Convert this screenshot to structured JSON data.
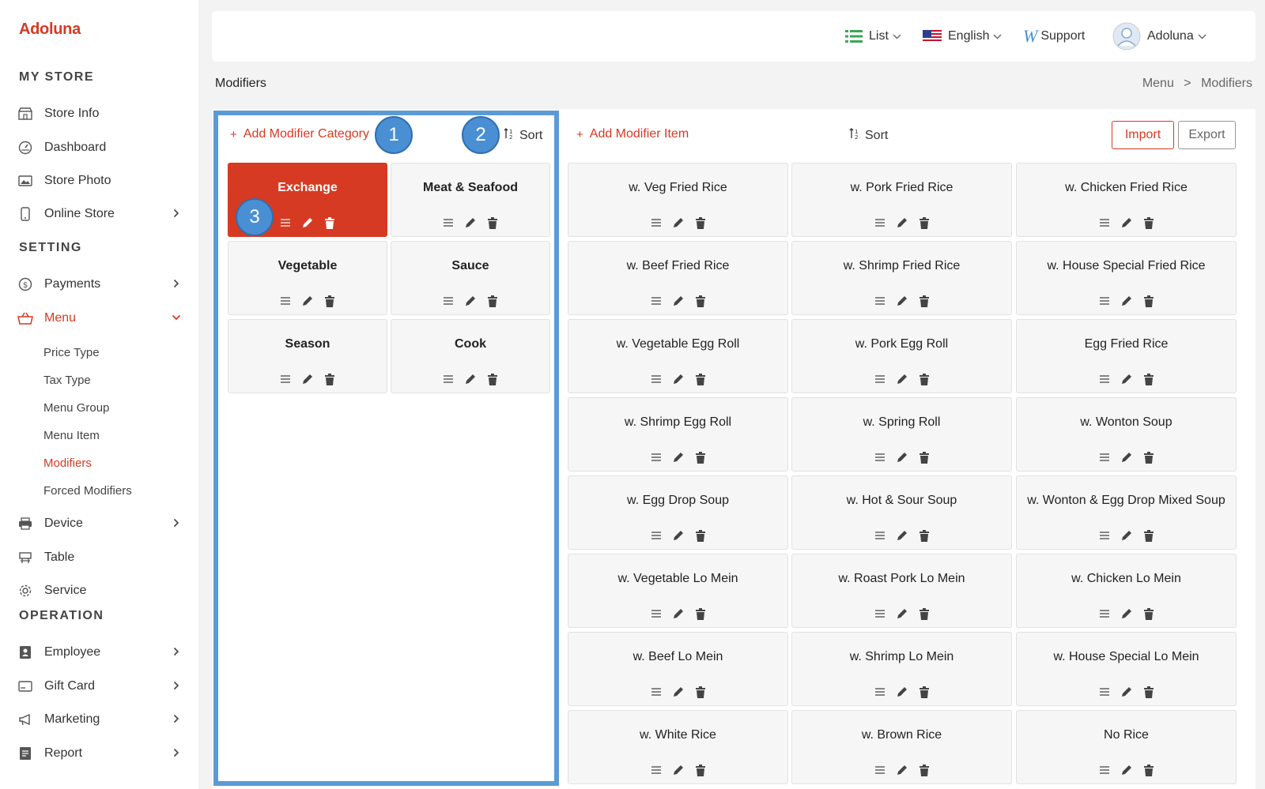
{
  "brand": "Adoluna",
  "sidebar": {
    "sections": {
      "my_store": "MY STORE",
      "setting": "SETTING",
      "operation": "OPERATION"
    },
    "items": {
      "store_info": "Store Info",
      "dashboard": "Dashboard",
      "store_photo": "Store Photo",
      "online_store": "Online Store",
      "payments": "Payments",
      "menu": "Menu",
      "device": "Device",
      "table": "Table",
      "service": "Service",
      "employee": "Employee",
      "gift_card": "Gift Card",
      "marketing": "Marketing",
      "report": "Report"
    },
    "menu_sub": {
      "price_type": "Price Type",
      "tax_type": "Tax Type",
      "menu_group": "Menu Group",
      "menu_item": "Menu Item",
      "modifiers": "Modifiers",
      "forced_modifiers": "Forced Modifiers"
    }
  },
  "topbar": {
    "view": "List",
    "language": "English",
    "support": "Support",
    "user": "Adoluna"
  },
  "page": {
    "title": "Modifiers",
    "crumb_parent": "Menu",
    "crumb_sep": ">",
    "crumb_current": "Modifiers"
  },
  "categories_panel": {
    "add_label": "Add Modifier Category",
    "sort_label": "Sort",
    "categories": [
      "Exchange",
      "Meat & Seafood",
      "Vegetable",
      "Sauce",
      "Season",
      "Cook"
    ],
    "selected_index": 0
  },
  "items_panel": {
    "add_label": "Add Modifier Item",
    "sort_label": "Sort",
    "import_label": "Import",
    "export_label": "Export",
    "items": [
      "w. Veg Fried Rice",
      "w. Pork Fried Rice",
      "w. Chicken Fried Rice",
      "w. Beef Fried Rice",
      "w. Shrimp Fried Rice",
      "w. House Special Fried Rice",
      "w. Vegetable Egg Roll",
      "w. Pork Egg Roll",
      "Egg Fried Rice",
      "w. Shrimp Egg Roll",
      "w. Spring Roll",
      "w. Wonton Soup",
      "w. Egg Drop Soup",
      "w. Hot & Sour Soup",
      "w. Wonton & Egg Drop Mixed Soup",
      "w. Vegetable Lo Mein",
      "w. Roast Pork Lo Mein",
      "w. Chicken Lo Mein",
      "w. Beef Lo Mein",
      "w. Shrimp Lo Mein",
      "w. House Special Lo Mein",
      "w. White Rice",
      "w. Brown Rice",
      "No Rice"
    ]
  },
  "annotations": [
    "1",
    "2",
    "3"
  ],
  "colors": {
    "accent": "#d63a22",
    "highlight": "#5b9bd5",
    "badge": "#4a8fd3"
  }
}
